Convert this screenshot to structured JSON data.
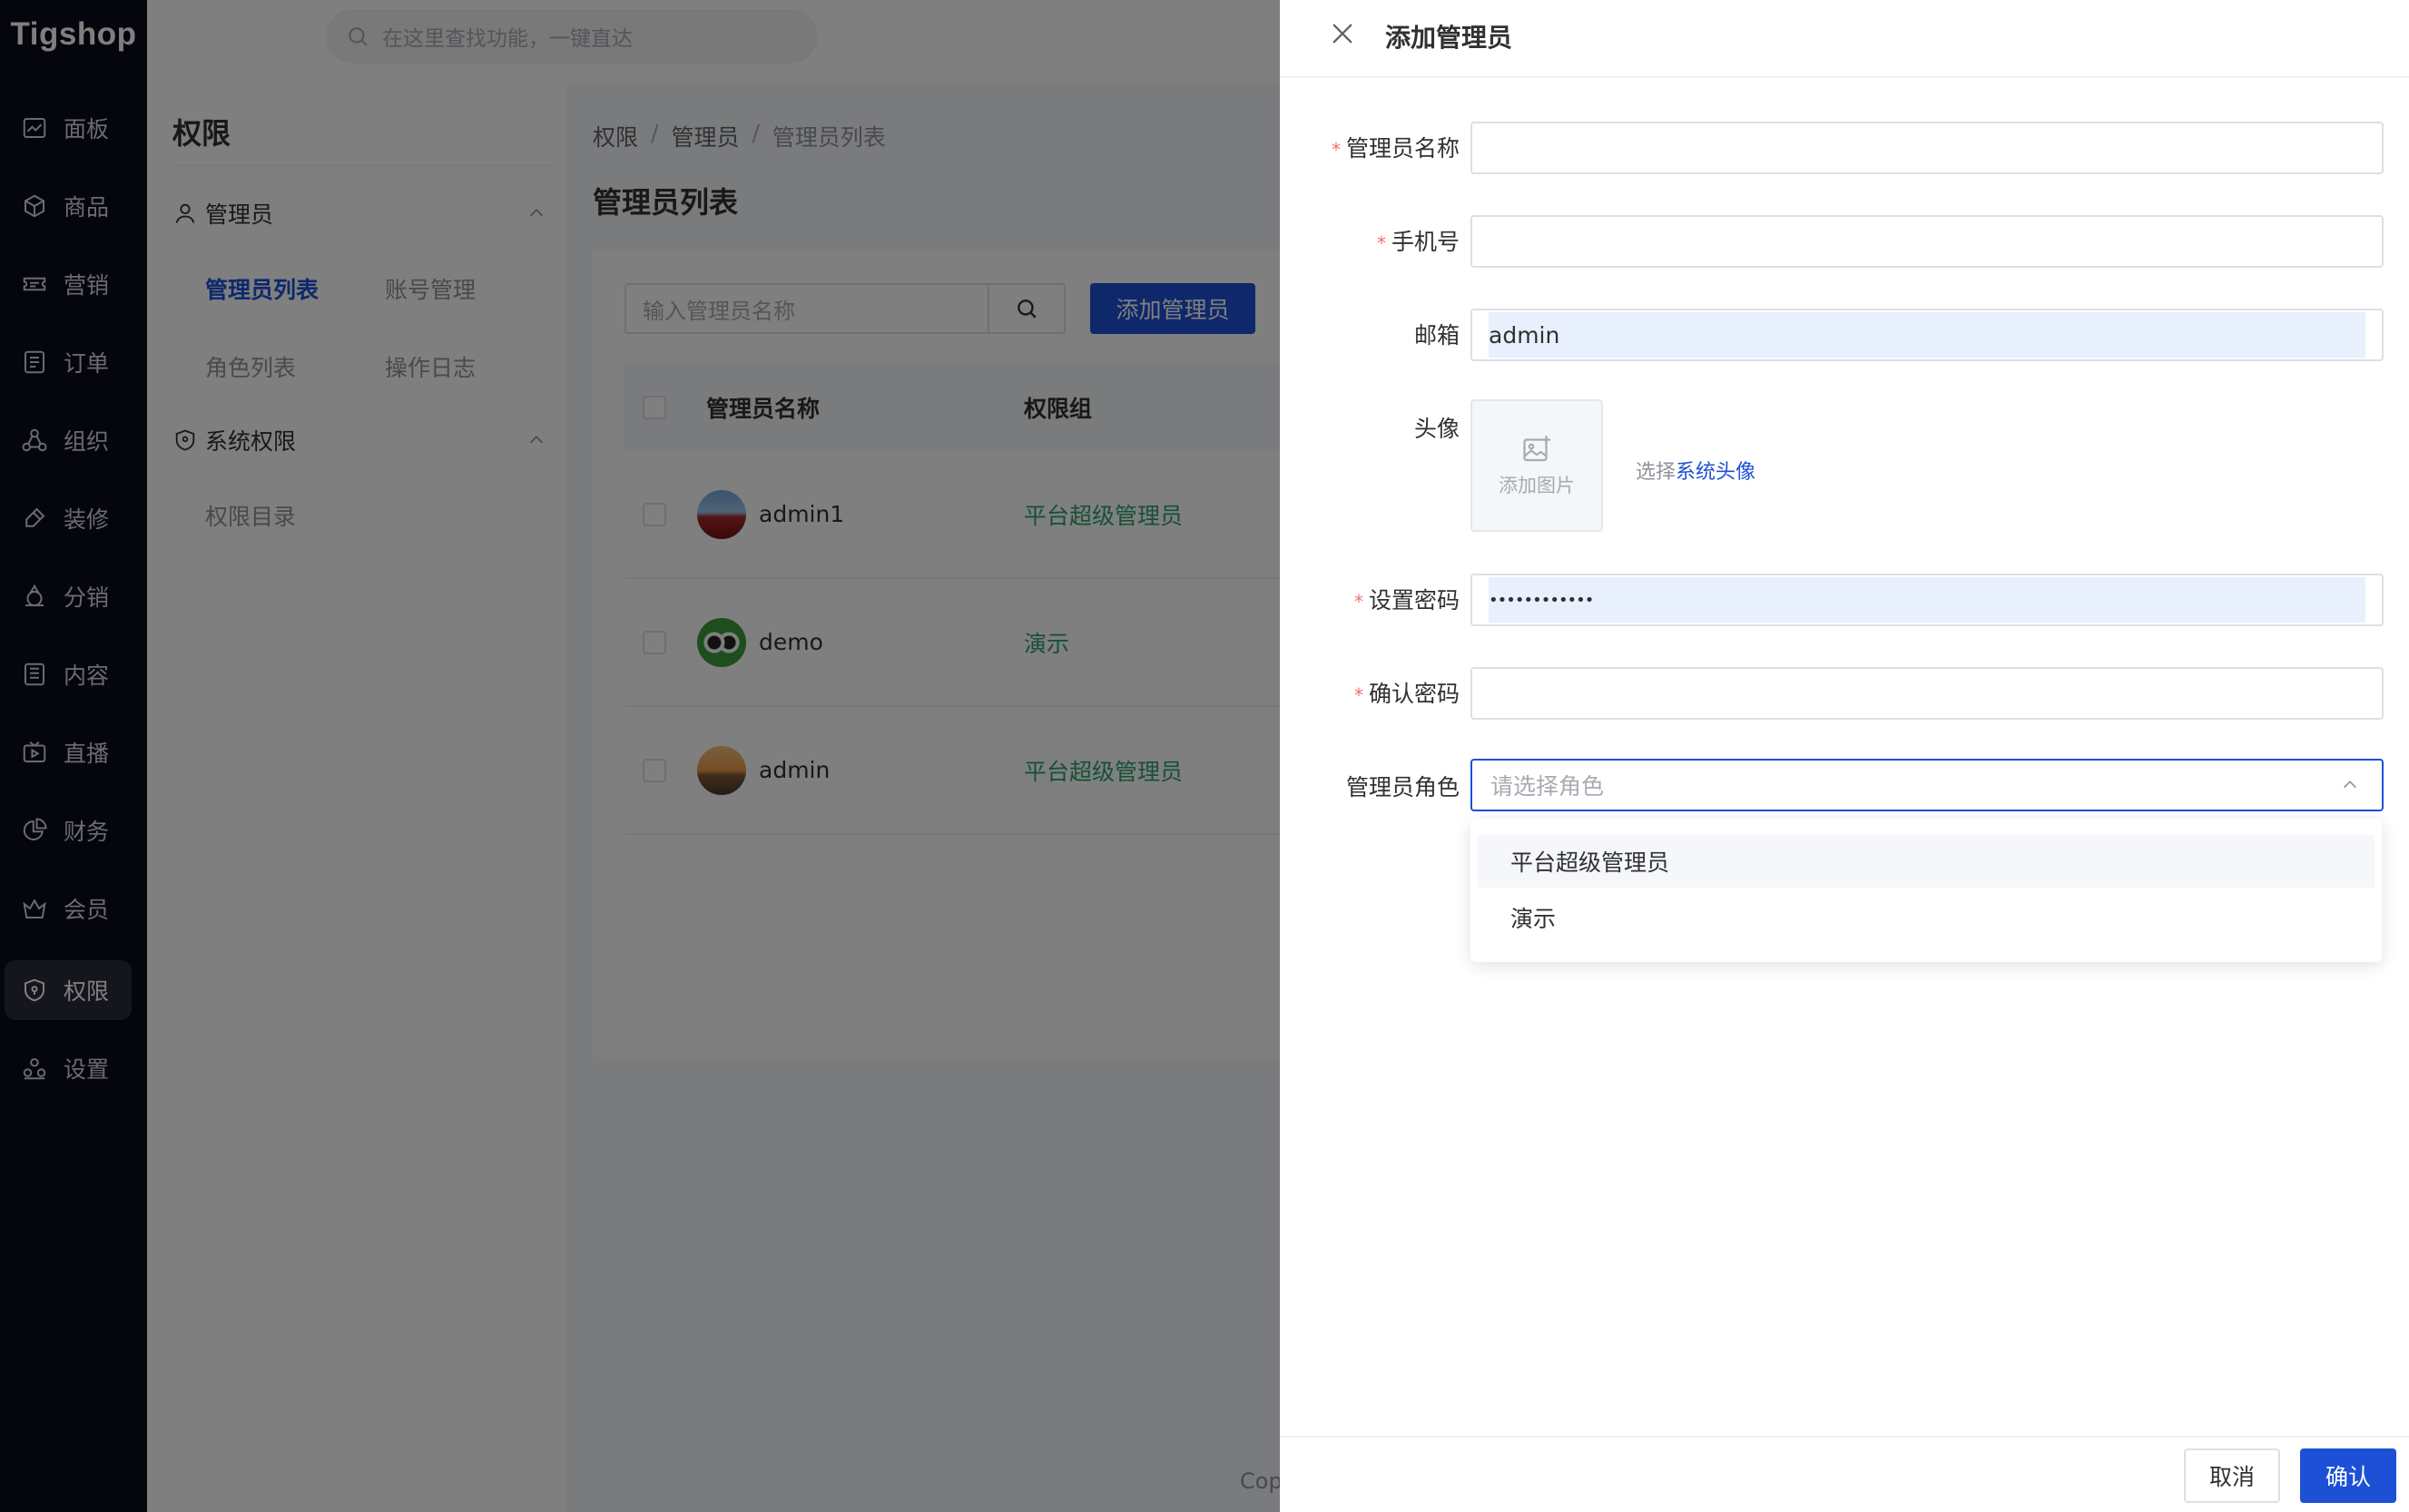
{
  "app": {
    "logo": "Tigshop"
  },
  "topbar": {
    "search_placeholder": "在这里查找功能，一键直达"
  },
  "sidebar": {
    "items": [
      {
        "label": "面板",
        "icon": "chart-line-icon"
      },
      {
        "label": "商品",
        "icon": "cube-icon"
      },
      {
        "label": "营销",
        "icon": "ticket-icon"
      },
      {
        "label": "订单",
        "icon": "order-list-icon"
      },
      {
        "label": "组织",
        "icon": "org-icon"
      },
      {
        "label": "装修",
        "icon": "brush-icon"
      },
      {
        "label": "分销",
        "icon": "share-icon"
      },
      {
        "label": "内容",
        "icon": "content-icon"
      },
      {
        "label": "直播",
        "icon": "live-icon"
      },
      {
        "label": "财务",
        "icon": "pie-icon"
      },
      {
        "label": "会员",
        "icon": "crown-icon"
      },
      {
        "label": "权限",
        "icon": "shield-icon",
        "active": true
      },
      {
        "label": "设置",
        "icon": "settings-icon"
      }
    ]
  },
  "subside": {
    "title": "权限",
    "group1": "管理员",
    "group1_links": [
      "管理员列表",
      "账号管理",
      "角色列表",
      "操作日志"
    ],
    "group2": "系统权限",
    "group2_links": [
      "权限目录"
    ]
  },
  "breadcrumb": [
    "权限",
    "/",
    "管理员",
    "/",
    "管理员列表"
  ],
  "page_title": "管理员列表",
  "toolbar": {
    "name_placeholder": "输入管理员名称",
    "add_label": "添加管理员"
  },
  "table": {
    "headers": [
      "管理员名称",
      "权限组"
    ],
    "rows": [
      {
        "name": "admin1",
        "role": "平台超级管理员"
      },
      {
        "name": "demo",
        "role": "演示"
      },
      {
        "name": "admin",
        "role": "平台超级管理员"
      }
    ]
  },
  "footer_text": "Cop",
  "drawer": {
    "title": "添加管理员",
    "labels": {
      "name": "管理员名称",
      "mobile": "手机号",
      "email": "邮箱",
      "avatar": "头像",
      "password": "设置密码",
      "confirm": "确认密码",
      "role": "管理员角色"
    },
    "required_mark": "*",
    "email_value": "admin",
    "password_value": "••••••••••••",
    "upload_label": "添加图片",
    "select_prefix": "选择",
    "select_link": "系统头像",
    "role_placeholder": "请选择角色",
    "role_options": [
      "平台超级管理员",
      "演示"
    ],
    "cancel_label": "取消",
    "ok_label": "确认"
  }
}
